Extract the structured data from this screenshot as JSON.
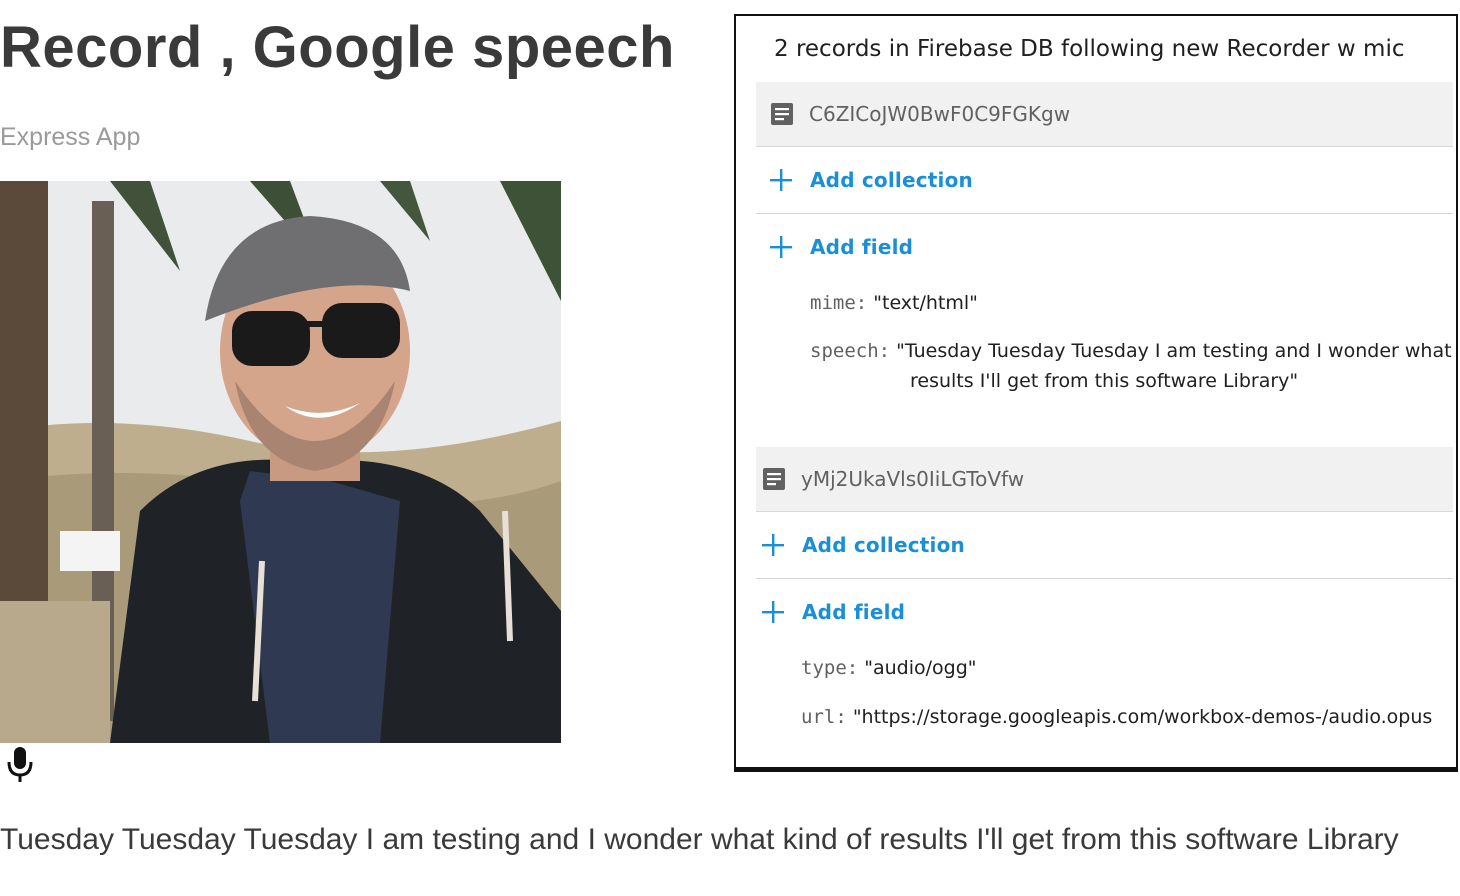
{
  "page": {
    "title": "Record , Google speech",
    "subtitle": "Express App",
    "transcript": "Tuesday Tuesday Tuesday I am testing and I wonder what kind of results I'll get from this software Library"
  },
  "icons": {
    "mic": "microphone-icon",
    "doc": "document-icon",
    "plus": "plus-icon"
  },
  "firebase": {
    "heading": "2 records in Firebase DB following new Recorder w mic",
    "records": [
      {
        "id": "C6ZICoJW0BwF0C9FGKgw",
        "add_collection": "Add collection",
        "add_field": "Add field",
        "fields": [
          {
            "key": "mime:",
            "value": "\"text/html\""
          },
          {
            "key": "speech:",
            "value": "\"Tuesday Tuesday Tuesday I am testing and I wonder what",
            "value2": "results I'll get from this software Library\""
          }
        ]
      },
      {
        "id": "yMj2UkaVls0IiLGToVfw",
        "add_collection": "Add collection",
        "add_field": "Add field",
        "fields": [
          {
            "key": "type:",
            "value": "\"audio/ogg\""
          },
          {
            "key": "url:",
            "value": "\"https://storage.googleapis.com/workbox-demos-/audio.opus"
          }
        ]
      }
    ]
  },
  "colors": {
    "title": "#3a3a3a",
    "subtitle": "#9a9a9a",
    "link_blue": "#1a8fd6",
    "doc_header_bg": "#f1f1f1"
  }
}
